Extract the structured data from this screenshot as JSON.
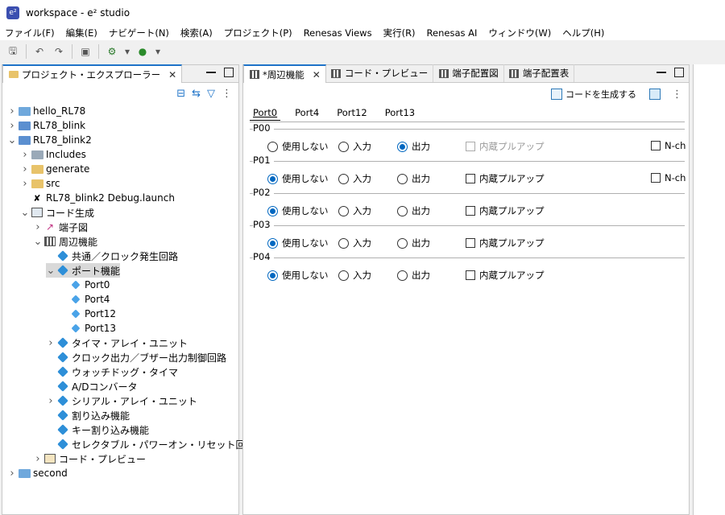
{
  "window": {
    "title": "workspace - e² studio",
    "app_icon": "e2-studio-icon"
  },
  "menu": [
    "ファイル(F)",
    "編集(E)",
    "ナビゲート(N)",
    "検索(A)",
    "プロジェクト(P)",
    "Renesas Views",
    "実行(R)",
    "Renesas AI",
    "ウィンドウ(W)",
    "ヘルプ(H)"
  ],
  "left_panel": {
    "tab_label": "プロジェクト・エクスプローラー",
    "tree": [
      {
        "label": "hello_RL78",
        "depth": 0,
        "twisty": "›",
        "icon": "folder-icon"
      },
      {
        "label": "RL78_blink",
        "depth": 0,
        "twisty": "›",
        "icon": "c-project-icon"
      },
      {
        "label": "RL78_blink2",
        "depth": 0,
        "twisty": "⌄",
        "icon": "c-project-icon"
      },
      {
        "label": "Includes",
        "depth": 1,
        "twisty": "›",
        "icon": "includes-icon"
      },
      {
        "label": "generate",
        "depth": 1,
        "twisty": "›",
        "icon": "source-folder-icon"
      },
      {
        "label": "src",
        "depth": 1,
        "twisty": "›",
        "icon": "source-folder-icon"
      },
      {
        "label": "RL78_blink2 Debug.launch",
        "depth": 1,
        "twisty": "",
        "icon": "launch-file-icon"
      },
      {
        "label": "コード生成",
        "depth": 1,
        "twisty": "⌄",
        "icon": "code-generator-icon"
      },
      {
        "label": "端子図",
        "depth": 2,
        "twisty": "›",
        "icon": "pin-diagram-icon"
      },
      {
        "label": "周辺機能",
        "depth": 2,
        "twisty": "⌄",
        "icon": "peripheral-icon"
      },
      {
        "label": "共通／クロック発生回路",
        "depth": 3,
        "twisty": "",
        "icon": "cube-icon"
      },
      {
        "label": "ポート機能",
        "depth": 3,
        "twisty": "⌄",
        "icon": "cube-icon",
        "selected": true
      },
      {
        "label": "Port0",
        "depth": 4,
        "twisty": "",
        "icon": "cube-small-icon"
      },
      {
        "label": "Port4",
        "depth": 4,
        "twisty": "",
        "icon": "cube-small-icon"
      },
      {
        "label": "Port12",
        "depth": 4,
        "twisty": "",
        "icon": "cube-small-icon"
      },
      {
        "label": "Port13",
        "depth": 4,
        "twisty": "",
        "icon": "cube-small-icon"
      },
      {
        "label": "タイマ・アレイ・ユニット",
        "depth": 3,
        "twisty": "›",
        "icon": "cube-icon"
      },
      {
        "label": "クロック出力／ブザー出力制御回路",
        "depth": 3,
        "twisty": "",
        "icon": "cube-icon"
      },
      {
        "label": "ウォッチドッグ・タイマ",
        "depth": 3,
        "twisty": "",
        "icon": "cube-icon"
      },
      {
        "label": "A/Dコンバータ",
        "depth": 3,
        "twisty": "",
        "icon": "cube-icon"
      },
      {
        "label": "シリアル・アレイ・ユニット",
        "depth": 3,
        "twisty": "›",
        "icon": "cube-icon"
      },
      {
        "label": "割り込み機能",
        "depth": 3,
        "twisty": "",
        "icon": "cube-icon"
      },
      {
        "label": "キー割り込み機能",
        "depth": 3,
        "twisty": "",
        "icon": "cube-icon"
      },
      {
        "label": "セレクタブル・パワーオン・リセット回路",
        "depth": 3,
        "twisty": "",
        "icon": "cube-icon"
      },
      {
        "label": "コード・プレビュー",
        "depth": 2,
        "twisty": "›",
        "icon": "code-preview-icon"
      },
      {
        "label": "second",
        "depth": 0,
        "twisty": "›",
        "icon": "folder-icon"
      }
    ]
  },
  "editor": {
    "tabs": [
      {
        "label": "*周辺機能",
        "active": true,
        "closable": true
      },
      {
        "label": "コード・プレビュー",
        "active": false
      },
      {
        "label": "端子配置図",
        "active": false
      },
      {
        "label": "端子配置表",
        "active": false
      }
    ],
    "generate_button": "コードを生成する",
    "port_tabs": [
      "Port0",
      "Port4",
      "Port12",
      "Port13"
    ],
    "active_port_tab": "Port0",
    "sections": [
      {
        "name": "P00",
        "options": [
          "使用しない",
          "入力",
          "出力"
        ],
        "selected": "出力",
        "pullup_label": "内蔵プルアップ",
        "pullup_checked": false,
        "pullup_disabled": true,
        "nch_label": "N-ch",
        "nch_checked": false
      },
      {
        "name": "P01",
        "options": [
          "使用しない",
          "入力",
          "出力"
        ],
        "selected": "使用しない",
        "pullup_label": "内蔵プルアップ",
        "pullup_checked": false,
        "pullup_disabled": false,
        "nch_label": "N-ch",
        "nch_checked": false
      },
      {
        "name": "P02",
        "options": [
          "使用しない",
          "入力",
          "出力"
        ],
        "selected": "使用しない",
        "pullup_label": "内蔵プルアップ",
        "pullup_checked": false,
        "pullup_disabled": false
      },
      {
        "name": "P03",
        "options": [
          "使用しない",
          "入力",
          "出力"
        ],
        "selected": "使用しない",
        "pullup_label": "内蔵プルアップ",
        "pullup_checked": false,
        "pullup_disabled": false
      },
      {
        "name": "P04",
        "options": [
          "使用しない",
          "入力",
          "出力"
        ],
        "selected": "使用しない",
        "pullup_label": "内蔵プルアップ",
        "pullup_checked": false,
        "pullup_disabled": false
      }
    ]
  },
  "colors": {
    "accent": "#0067c0",
    "tab_active": "#1e73c8",
    "selection": "#d9d9d9"
  }
}
